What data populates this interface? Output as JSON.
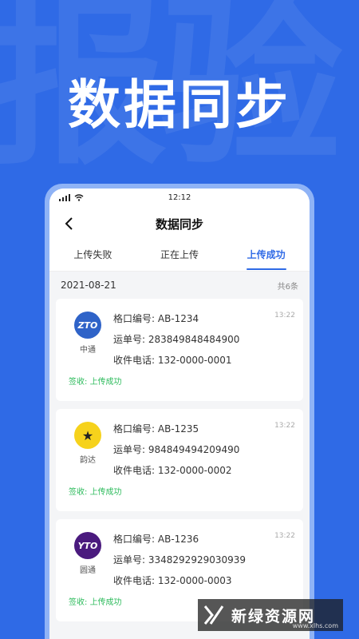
{
  "background": {
    "watermark": "报验"
  },
  "hero": {
    "title": "数据同步"
  },
  "statusbar": {
    "time": "12:12"
  },
  "nav": {
    "title": "数据同步"
  },
  "tabs": [
    {
      "label": "上传失败",
      "active": false
    },
    {
      "label": "正在上传",
      "active": false
    },
    {
      "label": "上传成功",
      "active": true
    }
  ],
  "summary": {
    "date": "2021-08-21",
    "count": "共6条"
  },
  "records": [
    {
      "courier": "中通",
      "logo_text": "ZTO",
      "logo_color": "#2f63c8",
      "slot_label": "格口编号:",
      "slot": "AB-1234",
      "waybill_label": "运单号:",
      "waybill": "283849848484900",
      "phone_label": "收件电话:",
      "phone": "132-0000-0001",
      "time": "13:22",
      "status_label": "签收:",
      "status": "上传成功"
    },
    {
      "courier": "韵达",
      "logo_text": "★",
      "logo_color": "#f6d21c",
      "slot_label": "格口编号:",
      "slot": "AB-1235",
      "waybill_label": "运单号:",
      "waybill": "984849494209490",
      "phone_label": "收件电话:",
      "phone": "132-0000-0002",
      "time": "13:22",
      "status_label": "签收:",
      "status": "上传成功"
    },
    {
      "courier": "圆通",
      "logo_text": "YTO",
      "logo_color": "#4a1a7e",
      "slot_label": "格口编号:",
      "slot": "AB-1236",
      "waybill_label": "运单号:",
      "waybill": "3348292929030939",
      "phone_label": "收件电话:",
      "phone": "132-0000-0003",
      "time": "13:22",
      "status_label": "签收:",
      "status": "上传成功"
    }
  ],
  "watermark_brand": {
    "name": "新绿资源网",
    "url": "www.xlhs.com"
  },
  "colors": {
    "accent": "#2f6ae6",
    "success": "#2dbb5c",
    "background": "#2f6ae6"
  }
}
